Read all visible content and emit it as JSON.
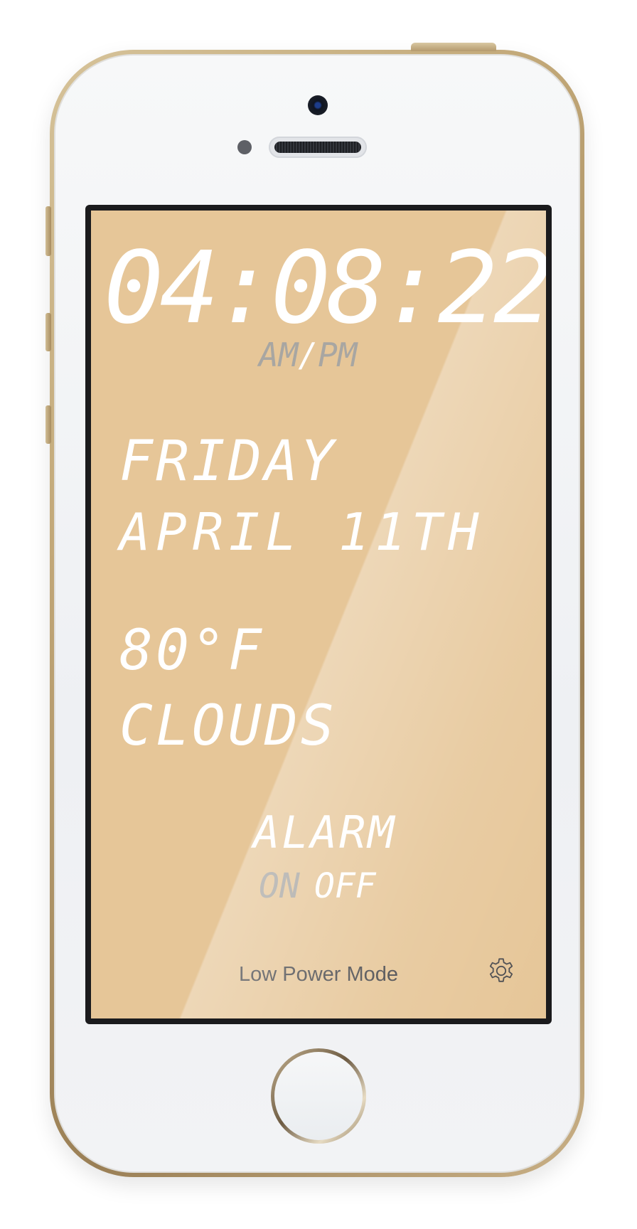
{
  "clock": {
    "time": "04:08:22",
    "am_pm": {
      "am_label": "AM",
      "separator": "/",
      "pm_label": "PM",
      "selected": "none"
    }
  },
  "date": {
    "weekday": "FRIDAY",
    "month_day": "APRIL 11TH"
  },
  "weather": {
    "temperature": "80°F",
    "condition": "CLOUDS"
  },
  "alarm": {
    "label": "ALARM",
    "on_label": "ON",
    "off_label": "OFF",
    "state": "off"
  },
  "footer": {
    "low_power_label": "Low Power Mode",
    "settings_icon": "gear-icon"
  },
  "colors": {
    "screen_background": "#e6c698",
    "lcd_active": "#ffffff",
    "lcd_inactive": "#a8a6a2",
    "device_trim": "#c2a878"
  }
}
